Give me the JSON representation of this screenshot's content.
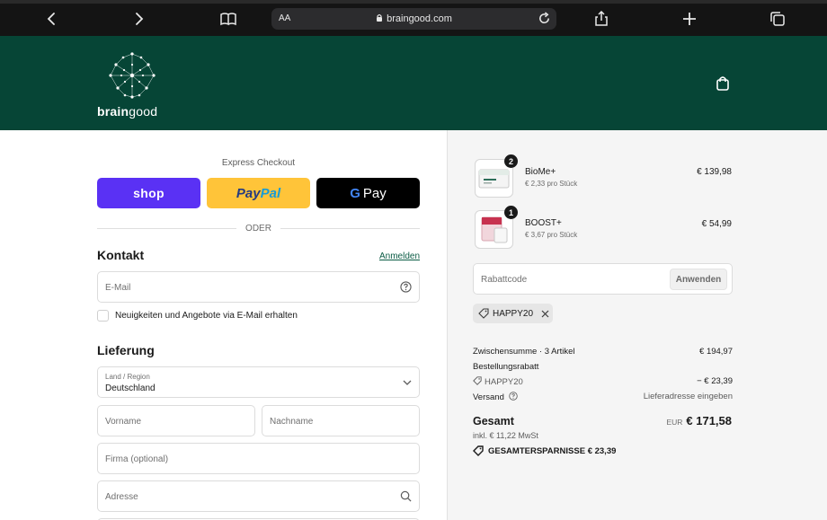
{
  "browser": {
    "aa_label": "AA",
    "url": "braingood.com"
  },
  "brand": {
    "name_bold": "brain",
    "name_light": "good",
    "header_color": "#064536"
  },
  "express": {
    "label": "Express Checkout",
    "shop_label": "shop",
    "paypal_part1": "Pay",
    "paypal_part2": "Pal",
    "gpay_g": "G",
    "gpay_label": "Pay",
    "divider": "ODER"
  },
  "contact": {
    "heading": "Kontakt",
    "login_link": "Anmelden",
    "email_placeholder": "E-Mail",
    "newsletter_label": "Neuigkeiten und Angebote via E-Mail erhalten"
  },
  "delivery": {
    "heading": "Lieferung",
    "country_label": "Land / Region",
    "country_value": "Deutschland",
    "firstname_placeholder": "Vorname",
    "lastname_placeholder": "Nachname",
    "company_placeholder": "Firma (optional)",
    "address_placeholder": "Adresse"
  },
  "cart": {
    "items": [
      {
        "name": "BioMe+",
        "unit_price": "€ 2,33 pro Stück",
        "price": "€ 139,98",
        "quantity": "2"
      },
      {
        "name": "BOOST+",
        "unit_price": "€ 3,67 pro Stück",
        "price": "€ 54,99",
        "quantity": "1"
      }
    ],
    "discount_placeholder": "Rabattcode",
    "apply_label": "Anwenden",
    "applied_code": "HAPPY20"
  },
  "summary": {
    "subtotal_label": "Zwischensumme · 3 Artikel",
    "subtotal_value": "€ 194,97",
    "order_discount_label": "Bestellungsrabatt",
    "order_discount_code": "HAPPY20",
    "order_discount_value": "− € 23,39",
    "shipping_label": "Versand",
    "shipping_value": "Lieferadresse eingeben",
    "total_label": "Gesamt",
    "currency": "EUR",
    "total_value": "€ 171,58",
    "tax_note": "inkl. € 11,22 MwSt",
    "savings_label": "GESAMTERSPARNISSE",
    "savings_value": "€ 23,39"
  }
}
